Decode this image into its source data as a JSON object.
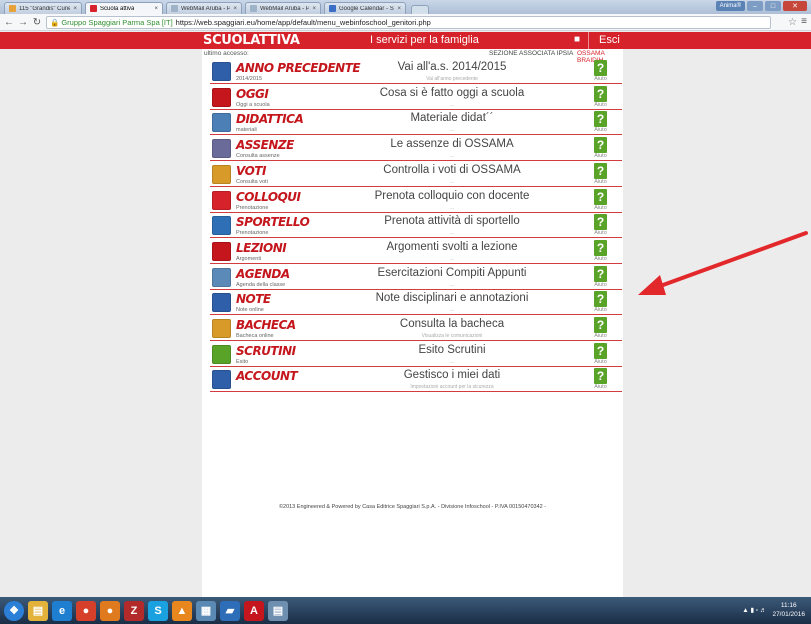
{
  "browser": {
    "tabs": [
      {
        "label": "115 \"Grandis\" Cuneo",
        "color": "#e8a23a",
        "active": false
      },
      {
        "label": "Scuola attiva",
        "color": "#d6222a",
        "active": true
      },
      {
        "label": "WebMail Aruba - Posta in",
        "color": "#9fb3c8",
        "active": false
      },
      {
        "label": "WebMail Aruba - Posta in",
        "color": "#9fb3c8",
        "active": false
      },
      {
        "label": "Google Calendar - Settim",
        "color": "#3b6fc6",
        "active": false
      }
    ],
    "user_chip": "Anima®",
    "secure_label": "Gruppo Spaggiari Parma Spa [IT]",
    "url": "https://web.spaggiari.eu/home/app/default/menu_webinfoschool_genitori.php"
  },
  "header": {
    "logo": "SCUOLATTIVA",
    "title": "I servizi per la famiglia",
    "logout": "Esci"
  },
  "subheader": {
    "last_access": "ultimo accesso:",
    "section": "SEZIONE ASSOCIATA IPSIA",
    "student": "OSSAMA BRAIDIH"
  },
  "help_label": "Aiuto",
  "rows": [
    {
      "name": "ANNO PRECEDENTE",
      "sub": "2014/2015",
      "desc": "Vai all'a.s. 2014/2015",
      "desc2": "Vai all'anno precedente",
      "icon": "calendar-back-icon",
      "color": "#2f5fa8"
    },
    {
      "name": "OGGI",
      "sub": "Oggi a scuola",
      "desc": "Cosa si è fatto oggi a scuola",
      "desc2": "...",
      "icon": "calendar-15-icon",
      "color": "#c4161c"
    },
    {
      "name": "DIDATTICA",
      "sub": "materiali",
      "desc": "Materiale didat´´",
      "desc2": "...",
      "icon": "whiteboard-icon",
      "color": "#4b7fb5"
    },
    {
      "name": "ASSENZE",
      "sub": "Consulta assenze",
      "desc": "Le assenze di OSSAMA",
      "desc2": "...",
      "icon": "grid-calendar-icon",
      "color": "#6b6b9a"
    },
    {
      "name": "VOTI",
      "sub": "Consulta voti",
      "desc": "Controlla i voti di OSSAMA",
      "desc2": "...",
      "icon": "grade-7-icon",
      "color": "#d89b2a"
    },
    {
      "name": "COLLOQUI",
      "sub": "Prenotazione",
      "desc": "Prenota colloquio con docente",
      "desc2": "...",
      "icon": "meeting-icon",
      "color": "#d6222a"
    },
    {
      "name": "SPORTELLO",
      "sub": "Prenotazione",
      "desc": "Prenota attività di sportello",
      "desc2": "...",
      "icon": "person-desk-icon",
      "color": "#2f6fb5"
    },
    {
      "name": "LEZIONI",
      "sub": "Argomenti",
      "desc": "Argomenti svolti a lezione",
      "desc2": "...",
      "icon": "teacher-icon",
      "color": "#c4161c"
    },
    {
      "name": "AGENDA",
      "sub": "Agenda della classe",
      "desc": "Esercitazioni Compiti Appunti",
      "desc2": "...",
      "icon": "agenda-icon",
      "color": "#5c8ab8"
    },
    {
      "name": "NOTE",
      "sub": "Note online",
      "desc": "Note disciplinari e annotazioni",
      "desc2": "...",
      "icon": "notes-people-icon",
      "color": "#2f5fa8"
    },
    {
      "name": "BACHECA",
      "sub": "Bacheca online",
      "desc": "Consulta la bacheca",
      "desc2": "Visualizza le comunicazioni",
      "icon": "noticeboard-icon",
      "color": "#d89b2a"
    },
    {
      "name": "SCRUTINI",
      "sub": "Esito",
      "desc": "Esito Scrutini",
      "desc2": "...",
      "icon": "report-card-icon",
      "color": "#5aa329"
    },
    {
      "name": "ACCOUNT",
      "sub": "",
      "desc": "Gestisco i miei dati",
      "desc2": "Impostazioni account per la sicurezza",
      "icon": "account-icon",
      "color": "#2f5fa8"
    }
  ],
  "footer": "©2013 Engineered & Powered by Casa Editrice Spaggiari S.p.A. - Divisione Infoschool - P.IVA 00150470342 -",
  "taskbar": {
    "apps": [
      {
        "icon": "start-orb-icon",
        "glyph": "❖",
        "color": "#2c7fd6"
      },
      {
        "icon": "file-explorer-icon",
        "glyph": "▤",
        "color": "#e2b23a"
      },
      {
        "icon": "internet-explorer-icon",
        "glyph": "e",
        "color": "#1e7fd0"
      },
      {
        "icon": "chrome-icon",
        "glyph": "●",
        "color": "#d6402a"
      },
      {
        "icon": "firefox-icon",
        "glyph": "●",
        "color": "#e07a1f"
      },
      {
        "icon": "filezilla-icon",
        "glyph": "Z",
        "color": "#b32a2a"
      },
      {
        "icon": "skype-icon",
        "glyph": "S",
        "color": "#1aa1e0"
      },
      {
        "icon": "vlc-icon",
        "glyph": "▲",
        "color": "#e8871e"
      },
      {
        "icon": "calculator-icon",
        "glyph": "▦",
        "color": "#5a8ab3"
      },
      {
        "icon": "outlook-icon",
        "glyph": "▰",
        "color": "#2e6db8"
      },
      {
        "icon": "acrobat-icon",
        "glyph": "A",
        "color": "#c4161c"
      },
      {
        "icon": "notepad-icon",
        "glyph": "▤",
        "color": "#6f8fb0"
      }
    ],
    "time": "11:16",
    "date": "27/01/2016"
  }
}
